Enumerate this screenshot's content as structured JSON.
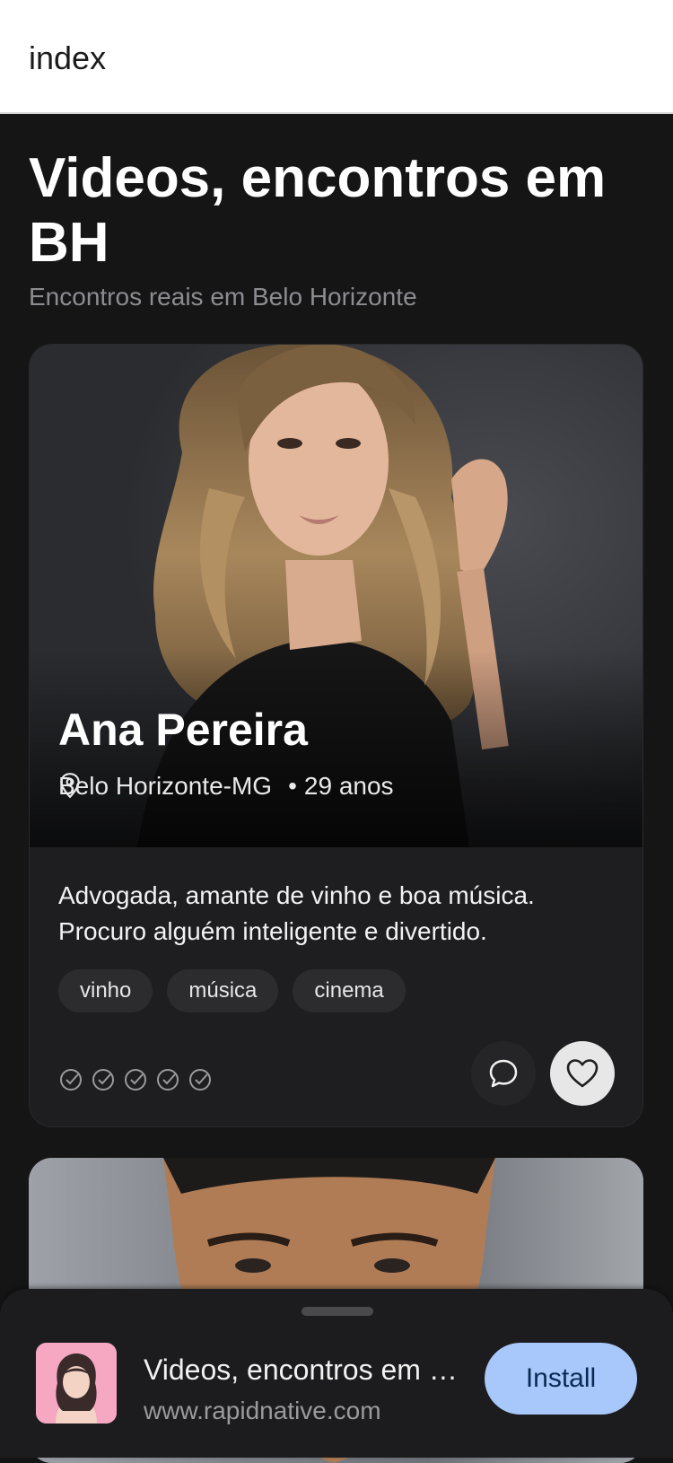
{
  "header": {
    "title": "index"
  },
  "page": {
    "heading": "Videos, encontros em BH",
    "subtitle": "Encontros reais em Belo Horizonte"
  },
  "profile": {
    "name": "Ana Pereira",
    "location": "Belo Horizonte-MG",
    "age": "29 anos",
    "bio": "Advogada, amante de vinho e boa música. Procuro alguém inteligente e divertido.",
    "tags": [
      "vinho",
      "música",
      "cinema"
    ],
    "verification_count": 5
  },
  "install_banner": {
    "app_name": "Videos, encontros em BH",
    "url": "www.rapidnative.com",
    "button_label": "Install"
  },
  "colors": {
    "background": "#151516",
    "card": "#1e1e20",
    "install_button": "#a8c7fa"
  }
}
